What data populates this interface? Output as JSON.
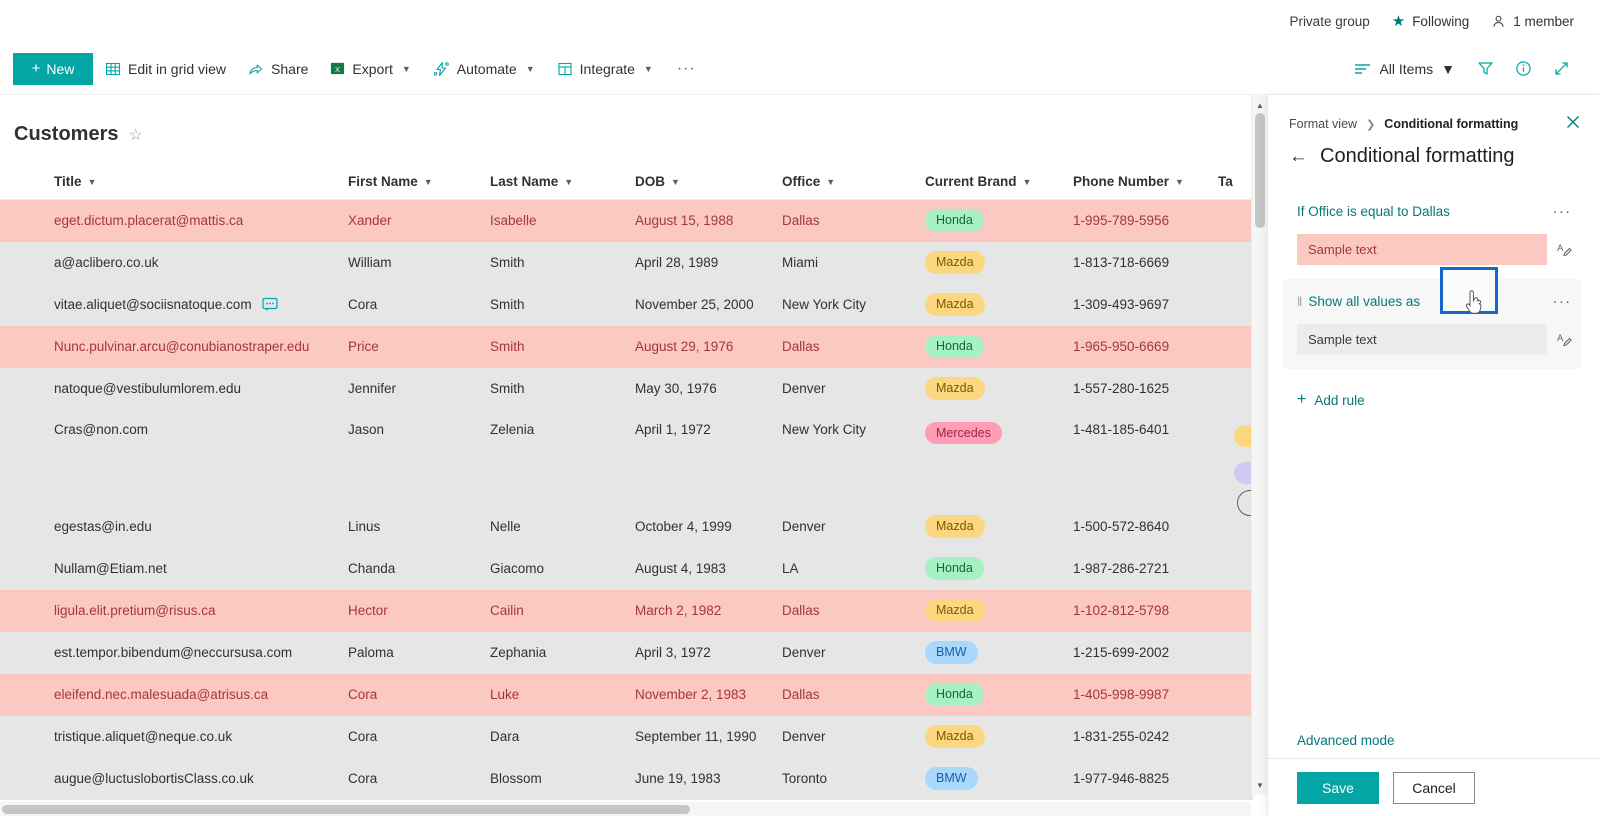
{
  "suite_bar": {
    "private_group": "Private group",
    "following": "Following",
    "member_count": "1 member"
  },
  "command_bar": {
    "new_label": "New",
    "items": [
      {
        "label": "Edit in grid view",
        "icon": "grid-icon",
        "has_chevron": false
      },
      {
        "label": "Share",
        "icon": "share-icon",
        "has_chevron": false
      },
      {
        "label": "Export",
        "icon": "excel-icon",
        "has_chevron": true
      },
      {
        "label": "Automate",
        "icon": "automate-icon",
        "has_chevron": true
      },
      {
        "label": "Integrate",
        "icon": "integrate-icon",
        "has_chevron": true
      }
    ],
    "overflow_label": "···",
    "view_selector": "All Items",
    "right_icons": [
      "filter-icon",
      "info-icon",
      "expand-icon"
    ]
  },
  "list": {
    "title": "Customers",
    "favorite_icon": "star-outline-icon",
    "columns": [
      "Title",
      "First Name",
      "Last Name",
      "DOB",
      "Office",
      "Current Brand",
      "Phone Number",
      "Ta"
    ],
    "rows": [
      {
        "title": "eget.dictum.placerat@mattis.ca",
        "first": "Xander",
        "last": "Isabelle",
        "dob": "August 15, 1988",
        "office": "Dallas",
        "brand": "Honda",
        "phone": "1-995-789-5956",
        "highlight": true,
        "comment": false,
        "tall": false
      },
      {
        "title": "a@aclibero.co.uk",
        "first": "William",
        "last": "Smith",
        "dob": "April 28, 1989",
        "office": "Miami",
        "brand": "Mazda",
        "phone": "1-813-718-6669",
        "highlight": false,
        "comment": false,
        "tall": false
      },
      {
        "title": "vitae.aliquet@sociisnatoque.com",
        "first": "Cora",
        "last": "Smith",
        "dob": "November 25, 2000",
        "office": "New York City",
        "brand": "Mazda",
        "phone": "1-309-493-9697",
        "highlight": false,
        "comment": true,
        "tall": false
      },
      {
        "title": "Nunc.pulvinar.arcu@conubianostraper.edu",
        "first": "Price",
        "last": "Smith",
        "dob": "August 29, 1976",
        "office": "Dallas",
        "brand": "Honda",
        "phone": "1-965-950-6669",
        "highlight": true,
        "comment": false,
        "tall": false
      },
      {
        "title": "natoque@vestibulumlorem.edu",
        "first": "Jennifer",
        "last": "Smith",
        "dob": "May 30, 1976",
        "office": "Denver",
        "brand": "Mazda",
        "phone": "1-557-280-1625",
        "highlight": false,
        "comment": false,
        "tall": false
      },
      {
        "title": "Cras@non.com",
        "first": "Jason",
        "last": "Zelenia",
        "dob": "April 1, 1972",
        "office": "New York City",
        "brand": "Mercedes",
        "phone": "1-481-185-6401",
        "highlight": false,
        "comment": false,
        "tall": true
      },
      {
        "title": "egestas@in.edu",
        "first": "Linus",
        "last": "Nelle",
        "dob": "October 4, 1999",
        "office": "Denver",
        "brand": "Mazda",
        "phone": "1-500-572-8640",
        "highlight": false,
        "comment": false,
        "tall": false
      },
      {
        "title": "Nullam@Etiam.net",
        "first": "Chanda",
        "last": "Giacomo",
        "dob": "August 4, 1983",
        "office": "LA",
        "brand": "Honda",
        "phone": "1-987-286-2721",
        "highlight": false,
        "comment": false,
        "tall": false
      },
      {
        "title": "ligula.elit.pretium@risus.ca",
        "first": "Hector",
        "last": "Cailin",
        "dob": "March 2, 1982",
        "office": "Dallas",
        "brand": "Mazda",
        "phone": "1-102-812-5798",
        "highlight": true,
        "comment": false,
        "tall": false
      },
      {
        "title": "est.tempor.bibendum@neccursusa.com",
        "first": "Paloma",
        "last": "Zephania",
        "dob": "April 3, 1972",
        "office": "Denver",
        "brand": "BMW",
        "phone": "1-215-699-2002",
        "highlight": false,
        "comment": false,
        "tall": false
      },
      {
        "title": "eleifend.nec.malesuada@atrisus.ca",
        "first": "Cora",
        "last": "Luke",
        "dob": "November 2, 1983",
        "office": "Dallas",
        "brand": "Honda",
        "phone": "1-405-998-9987",
        "highlight": true,
        "comment": false,
        "tall": false
      },
      {
        "title": "tristique.aliquet@neque.co.uk",
        "first": "Cora",
        "last": "Dara",
        "dob": "September 11, 1990",
        "office": "Denver",
        "brand": "Mazda",
        "phone": "1-831-255-0242",
        "highlight": false,
        "comment": false,
        "tall": false
      },
      {
        "title": "augue@luctuslobortisClass.co.uk",
        "first": "Cora",
        "last": "Blossom",
        "dob": "June 19, 1983",
        "office": "Toronto",
        "brand": "BMW",
        "phone": "1-977-946-8825",
        "highlight": false,
        "comment": false,
        "tall": false
      }
    ]
  },
  "panel": {
    "breadcrumb_root": "Format view",
    "breadcrumb_current": "Conditional formatting",
    "title": "Conditional formatting",
    "close_icon": "close-icon",
    "back_icon": "back-arrow-icon",
    "rules": [
      {
        "label": "If Office is equal to Dallas",
        "sample_text": "Sample text",
        "more_icon": "ellipsis-icon",
        "style_icon": "font-style-icon",
        "swatch": "#fbc9c2",
        "focused": false,
        "draggable": false
      },
      {
        "label": "Show all values as",
        "sample_text": "Sample text",
        "more_icon": "ellipsis-icon",
        "style_icon": "font-style-icon",
        "swatch": "#ececec",
        "focused": true,
        "draggable": true
      }
    ],
    "add_rule_label": "Add rule",
    "advanced_mode_label": "Advanced mode",
    "save_label": "Save",
    "cancel_label": "Cancel"
  },
  "colors": {
    "accent": "#03a5a5",
    "link": "#03787c",
    "dallas_row_bg": "#fbc9c2",
    "dallas_row_text": "#a4363e",
    "row_bg": "#e6e6e6",
    "focus_ring": "#1667c9",
    "pill_honda_bg": "#a7f0c4",
    "pill_mazda_bg": "#fbd77f",
    "pill_mercedes_bg": "#ff9db5",
    "pill_bmw_bg": "#a8d8fb"
  }
}
